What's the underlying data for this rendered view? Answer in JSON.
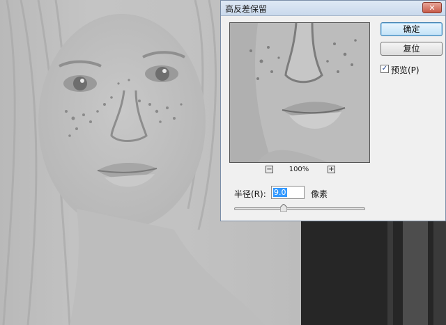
{
  "dialog": {
    "title": "高反差保留",
    "close_glyph": "✕",
    "ok_label": "确定",
    "reset_label": "复位",
    "preview_label": "预览(P)",
    "preview_checked": true,
    "zoom_level": "100%",
    "zoom_out_glyph": "−",
    "zoom_in_glyph": "+",
    "radius_label": "半径(R):",
    "radius_value": "9.0",
    "radius_unit": "像素",
    "radius_slider_fraction": 0.38
  },
  "icons": {
    "close": "close-icon",
    "zoom_out": "zoom-out-icon",
    "zoom_in": "zoom-in-icon",
    "check": "checkmark-icon"
  },
  "colors": {
    "dialog_bg": "#f0f0f0",
    "title_bar": "#c9d9ec",
    "default_button": "#c2e2f7",
    "selection": "#3399ff",
    "workspace": "#262626"
  }
}
